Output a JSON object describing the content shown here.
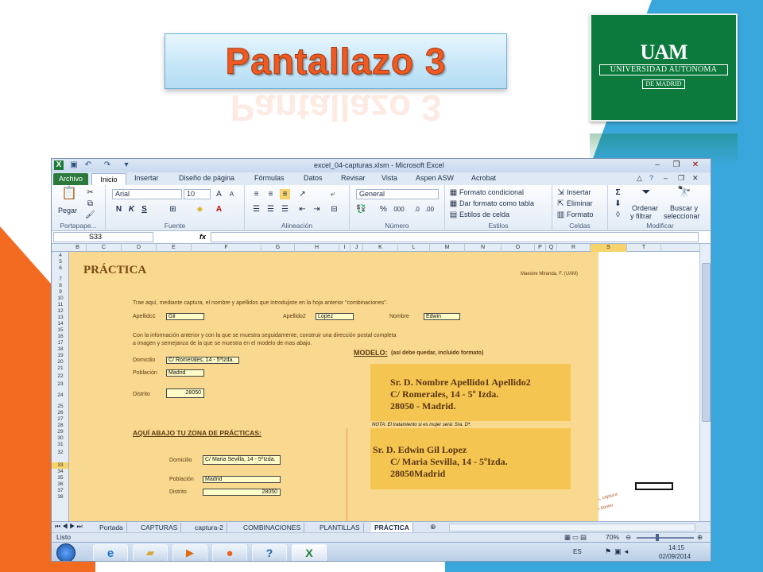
{
  "slide": {
    "title": "Pantallazo 3",
    "logo": {
      "mark": "UAM",
      "name": "UNIVERSIDAD AUTONOMA",
      "city": "DE MADRID"
    }
  },
  "excel": {
    "window_title": "excel_04-capturas.xlsm - Microsoft Excel",
    "tabs": [
      "Archivo",
      "Inicio",
      "Insertar",
      "Diseño de página",
      "Fórmulas",
      "Datos",
      "Revisar",
      "Vista",
      "Aspen ASW",
      "Acrobat"
    ],
    "ribbon": {
      "portapapeles": {
        "label": "Portapape...",
        "pegar": "Pegar"
      },
      "fuente": {
        "label": "Fuente",
        "font": "Arial",
        "size": "10",
        "bold": "N",
        "italic": "K",
        "underline": "S"
      },
      "alineacion": {
        "label": "Alineación"
      },
      "numero": {
        "label": "Número",
        "format": "General",
        "percent": "%",
        "thousands": "000"
      },
      "estilos": {
        "label": "Estilos",
        "cond": "Formato condicional",
        "table": "Dar formato como tabla",
        "cell": "Estilos de celda"
      },
      "celdas": {
        "label": "Celdas",
        "insert": "Insertar",
        "delete": "Eliminar",
        "format": "Formato"
      },
      "modificar": {
        "label": "Modificar",
        "sort": "Ordenar",
        "sort2": "y filtrar",
        "find": "Buscar y",
        "find2": "seleccionar",
        "sigma": "Σ"
      }
    },
    "formula_bar": {
      "name_box": "S33",
      "fx": "fx",
      "value": ""
    },
    "columns": [
      "B",
      "C",
      "D",
      "E",
      "F",
      "G",
      "H",
      "I",
      "J",
      "K",
      "L",
      "M",
      "N",
      "O",
      "P",
      "Q",
      "R",
      "S",
      "T"
    ],
    "rows": [
      "4",
      "5",
      "6",
      "7",
      "8",
      "9",
      "10",
      "11",
      "12",
      "13",
      "14",
      "15",
      "16",
      "17",
      "18",
      "19",
      "20",
      "21",
      "22",
      "23",
      "24",
      "25",
      "26",
      "27",
      "28",
      "29",
      "30",
      "31",
      "32",
      "33",
      "34",
      "35",
      "36",
      "37",
      "38"
    ],
    "sheet": {
      "heading": "PRÁCTICA",
      "author": "Maestre Miranda, F. (UAM)",
      "instr1": "Trae aquí, mediante captura, el nombre y apellidos que introdujiste en la hoja anterior \"combinaciones\".",
      "apellido1_label": "Apellido1",
      "apellido1": "Gil",
      "apellido2_label": "Apellido2",
      "apellido2": "Lopez",
      "nombre_label": "Nombre",
      "nombre": "Edwin",
      "instr2a": "Con la información anterior y con la que se muestra seguidamente, construir una dirección postal completa",
      "instr2b": "a imagen y semejanza de la que se muestra en el modelo de mas abajo.",
      "modelo_label": "MODELO:",
      "modelo_note": "(así debe quedar, incluido formato)",
      "domicilio_label": "Domicilio",
      "domicilio": "C/ Romerales, 14 - 5ºIzda.",
      "poblacion_label": "Población",
      "poblacion": "Madrid",
      "distrito_label": "Distrito",
      "distrito": "28050",
      "model_line1": "Sr. D. Nombre Apellido1 Apellido2",
      "model_line2": "C/ Romerales, 14 - 5º Izda.",
      "model_line3": "28050 - Madrid.",
      "nota": "NOTA: El tratamiento si es mujer será: Sra. Dª.",
      "zona": "AQUÍ ABAJO TU ZONA DE PRÁCTICAS:",
      "p_domicilio_label": "Domicilio",
      "p_domicilio": "C/ Maria Sevilla, 14 - 5ºIzda.",
      "p_poblacion_label": "Población",
      "p_poblacion": "Madrid",
      "p_distrito_label": "Distrito",
      "p_distrito": "28050",
      "result_line1": "Sr. D. Edwin Gil Lopez",
      "result_line2": "C/ Maria Sevilla, 14 - 5ºIzda.",
      "result_line3": "28050Madrid",
      "stamp_line1": "la  práctica, captura",
      "stamp_line2": "tu dosier."
    },
    "sheet_tabs": [
      "Portada",
      "CAPTURAS",
      "captura-2",
      "COMBINACIONES",
      "PLANTILLAS",
      "PRÁCTICA"
    ],
    "status": {
      "ready": "Listo",
      "zoom": "70%"
    },
    "taskbar": {
      "lang": "ES",
      "time": "14:15",
      "date": "02/09/2014"
    }
  },
  "colors": {
    "accent_orange": "#f05a22",
    "slide_blue": "#3aa7dc",
    "uam_green": "#0b7a3c",
    "sheet_fill": "#f9d98f",
    "model_fill": "#f5c552"
  }
}
